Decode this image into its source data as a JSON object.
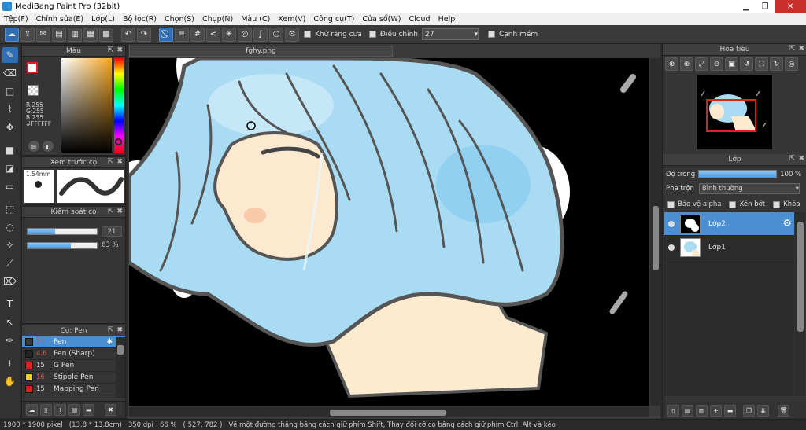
{
  "window": {
    "title": "MediBang Paint Pro (32bit)",
    "min": "▁",
    "max": "❐",
    "close": "✕"
  },
  "menu": [
    "Tệp(F)",
    "Chỉnh sửa(E)",
    "Lớp(L)",
    "Bộ lọc(R)",
    "Chọn(S)",
    "Chụp(N)",
    "Màu (C)",
    "Xem(V)",
    "Công cụ(T)",
    "Cửa sổ(W)",
    "Cloud",
    "Help"
  ],
  "toolbar": {
    "antialias_label": "Khử răng cưa",
    "adjust_label": "Điều chỉnh",
    "adjust_value": "27",
    "edge_label": "Cạnh mềm"
  },
  "color_panel": {
    "title": "Màu",
    "r": "R:255",
    "g": "G:255",
    "b": "B:255",
    "hex": "#FFFFFF",
    "fg_color": "#FFFFFF",
    "accent": "#E02020"
  },
  "preview_panel": {
    "title": "Xem trước cọ",
    "size": "1.54mm"
  },
  "brush_control": {
    "title": "Kiểm soát cọ",
    "size_value": "21",
    "size_fraction": 0.4,
    "opacity_value": "63 %",
    "opacity_fraction": 0.63
  },
  "brush_list": {
    "title": "Cọ: Pen",
    "items": [
      {
        "size": "21",
        "name": "Pen",
        "color": "#3a3a3a",
        "selected": true
      },
      {
        "size": "4.6",
        "name": "Pen (Sharp)",
        "color": "#222222",
        "selected": false
      },
      {
        "size": "15",
        "name": "G Pen",
        "color": "#e02020",
        "selected": false
      },
      {
        "size": "16",
        "name": "Stipple Pen",
        "color": "#e8d020",
        "selected": false
      },
      {
        "size": "15",
        "name": "Mapping Pen",
        "color": "#e02020",
        "selected": false
      }
    ]
  },
  "canvas": {
    "tab_title": "fghy.png"
  },
  "navigator": {
    "title": "Hoa tiêu"
  },
  "layers": {
    "title": "Lớp",
    "opacity_label": "Độ trong",
    "opacity_value": "100 %",
    "blend_label": "Pha trộn",
    "blend_value": "Bình thường",
    "check_alpha": "Bảo vệ alpha",
    "check_clip": "Xén bớt",
    "check_lock": "Khóa",
    "items": [
      {
        "name": "Lớp2",
        "selected": true
      },
      {
        "name": "Lớp1",
        "selected": false
      }
    ]
  },
  "status": {
    "size": "1900 * 1900 pixel",
    "physical": "(13.8 * 13.8cm)",
    "dpi": "350 dpi",
    "zoom": "66 %",
    "coords": "( 527, 782 )",
    "hint": "Vẽ một đường thẳng bằng cách giữ phím Shift, Thay đổi cỡ cọ bằng cách giữ phím Ctrl, Alt và kéo"
  }
}
